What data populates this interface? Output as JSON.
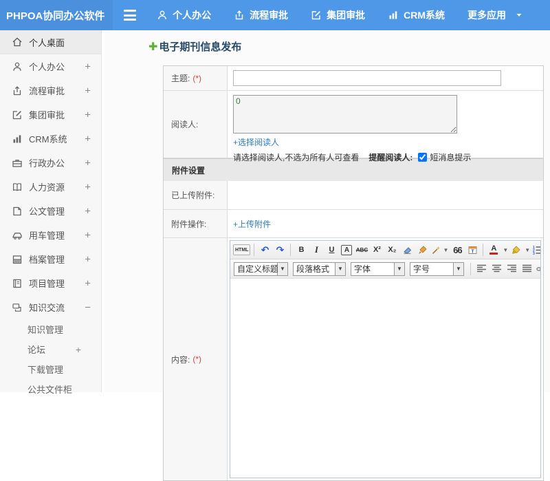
{
  "colors": {
    "topbar": "#4f98e8",
    "brand_bg": "#4a90dd",
    "link": "#2f7cc3",
    "required": "#e04040",
    "title": "#274a68",
    "plus_green": "#55b432"
  },
  "topbar": {
    "brand": "PHPOA协同办公软件",
    "nav": [
      {
        "label": "个人办公"
      },
      {
        "label": "流程审批"
      },
      {
        "label": "集团审批"
      },
      {
        "label": "CRM系统"
      },
      {
        "label": "更多应用"
      }
    ]
  },
  "sidebar": {
    "items": [
      {
        "label": "个人桌面",
        "expander": ""
      },
      {
        "label": "个人办公",
        "expander": "+"
      },
      {
        "label": "流程审批",
        "expander": "+"
      },
      {
        "label": "集团审批",
        "expander": "+"
      },
      {
        "label": "CRM系统",
        "expander": "+"
      },
      {
        "label": "行政办公",
        "expander": "+"
      },
      {
        "label": "人力资源",
        "expander": "+"
      },
      {
        "label": "公文管理",
        "expander": "+"
      },
      {
        "label": "用车管理",
        "expander": "+"
      },
      {
        "label": "档案管理",
        "expander": "+"
      },
      {
        "label": "项目管理",
        "expander": "+"
      },
      {
        "label": "知识交流",
        "expander": "−"
      }
    ],
    "subitems": [
      {
        "label": "知识管理",
        "expander": ""
      },
      {
        "label": "论坛",
        "expander": "+"
      },
      {
        "label": "下载管理",
        "expander": ""
      },
      {
        "label": "公共文件柜",
        "expander": ""
      }
    ]
  },
  "page": {
    "title": "电子期刊信息发布",
    "plus": "✚"
  },
  "form": {
    "subject_label": "主题:",
    "subject_required": "(*)",
    "readers_label": "阅读人:",
    "readers_count": "0",
    "select_readers": "+选择阅读人",
    "readers_hint": "请选择阅读人,不选为所有人可查看",
    "remind_label": "提醒阅读人:",
    "sms_label": "短消息提示",
    "sms_checked": true,
    "attach_section": "附件设置",
    "uploaded_label": "已上传附件:",
    "attach_op_label": "附件操作:",
    "upload_link": "+上传附件",
    "content_label": "内容:",
    "content_required": "(*)"
  },
  "editor": {
    "html": "HTML",
    "undo": "↶",
    "redo": "↷",
    "bold": "B",
    "italic": "I",
    "underline": "U",
    "fontbox": "A",
    "strike": "ABC",
    "sup": "X²",
    "sub": "X₂",
    "quote": "66",
    "fontcolor": "A",
    "selects": [
      {
        "label": "自定义标题"
      },
      {
        "label": "段落格式"
      },
      {
        "label": "字体"
      },
      {
        "label": "字号"
      }
    ]
  }
}
